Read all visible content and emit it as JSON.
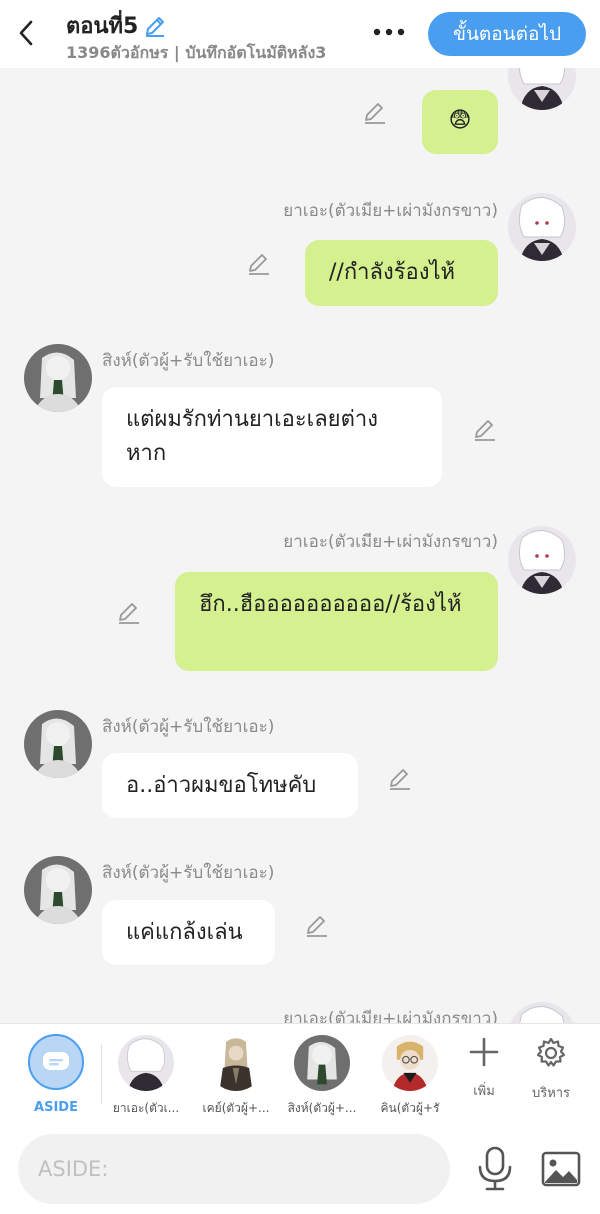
{
  "header": {
    "title": "ตอนที่5",
    "subtitle": "1396ตัวอักษร | บันทึกอัตโนมัติหลัง3",
    "next_label": "ขั้นตอนต่อไป",
    "accent": "#4a9ef0"
  },
  "messages": [
    {
      "side": "right",
      "name": "",
      "text": "😨"
    },
    {
      "side": "right",
      "name": "ยาเอะ(ตัวเมีย+เผ่ามังกรขาว)",
      "text": "//กำลังร้องไห้"
    },
    {
      "side": "left",
      "name": "สิงห์(ตัวผู้+รับใช้ยาเอะ)",
      "text": "แต่ผมรักท่านยาเอะเลยต่างหาก"
    },
    {
      "side": "right",
      "name": "ยาเอะ(ตัวเมีย+เผ่ามังกรขาว)",
      "text": "ฮึก..ฮืออออออออออ//ร้องไห้"
    },
    {
      "side": "left",
      "name": "สิงห์(ตัวผู้+รับใช้ยาเอะ)",
      "text": "อ..อ่าวผมขอโทษคับ"
    },
    {
      "side": "left",
      "name": "สิงห์(ตัวผู้+รับใช้ยาเอะ)",
      "text": "แค่แกล้งเล่น"
    },
    {
      "side": "right",
      "name": "ยาเอะ(ตัวเมีย+เผ่ามังกรขาว)",
      "text": ""
    }
  ],
  "characters": {
    "aside_label": "ASIDE",
    "items": [
      {
        "label": "ยาเอะ(ตัวเ..."
      },
      {
        "label": "เคย์(ตัวผู้+..."
      },
      {
        "label": "สิงห์(ตัวผู้+..."
      },
      {
        "label": "คิน(ตัวผู้+รั"
      }
    ],
    "add_label": "เพิ่ม",
    "manage_label": "บริหาร"
  },
  "input": {
    "placeholder": "ASIDE:"
  },
  "colors": {
    "right_bubble": "#d4f08f",
    "left_bubble": "#ffffff",
    "background": "#f4f4f4"
  }
}
